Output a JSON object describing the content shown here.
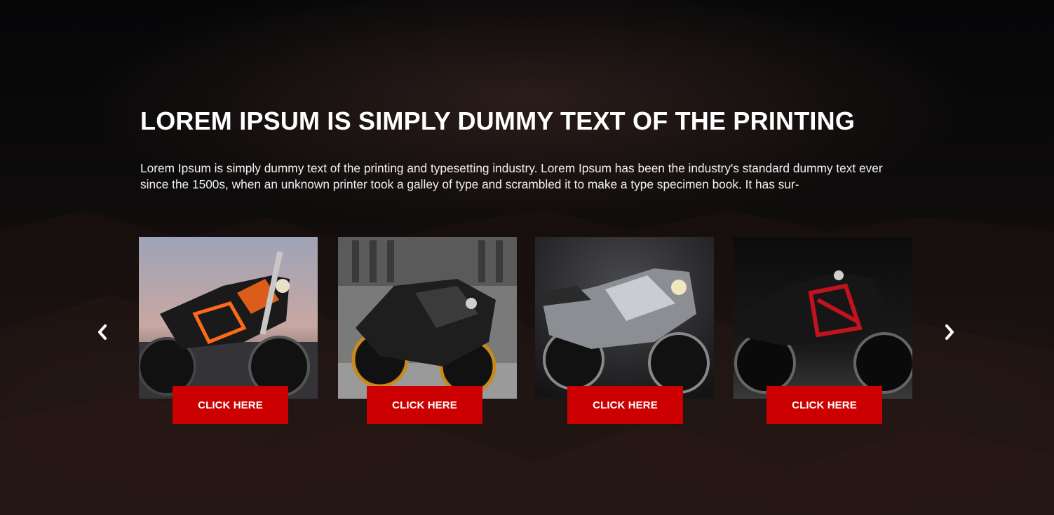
{
  "hero": {
    "title": "LOREM IPSUM IS SIMPLY DUMMY TEXT OF THE PRINTING",
    "description": "Lorem Ipsum is simply dummy text of the printing and typesetting industry. Lorem Ipsum has been the industry's standard dummy text ever since the 1500s, when an unknown printer took a galley of type and scrambled it to make a type specimen book. It has sur-"
  },
  "carousel": {
    "prev_icon": "chevron-left-icon",
    "next_icon": "chevron-right-icon",
    "items": [
      {
        "image": "orange-supermoto-motorcycle",
        "button_label": "CLICK HERE"
      },
      {
        "image": "black-gold-sportbike-motorcycle",
        "button_label": "CLICK HERE"
      },
      {
        "image": "silver-touring-motorcycle",
        "button_label": "CLICK HERE"
      },
      {
        "image": "black-red-naked-motorcycle",
        "button_label": "CLICK HERE"
      }
    ]
  },
  "colors": {
    "button": "#cc0000",
    "background": "#0b0a0a",
    "text": "#ffffff"
  }
}
